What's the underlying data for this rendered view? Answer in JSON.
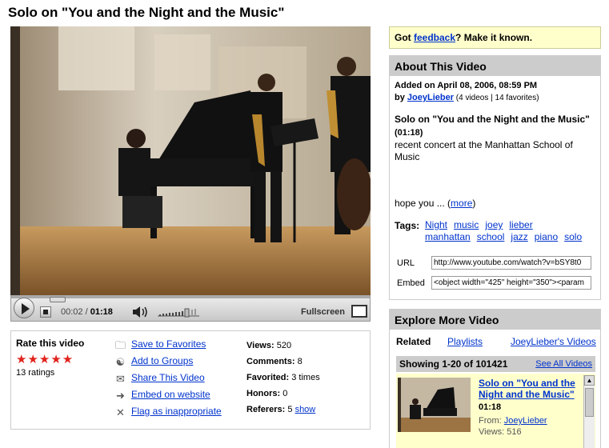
{
  "page": {
    "title": "Solo on \"You and the Night and the Music\""
  },
  "player": {
    "current_time": "00:02",
    "separator": "/",
    "duration": "01:18",
    "fullscreen_label": "Fullscreen"
  },
  "rating": {
    "label": "Rate this video",
    "stars": "★★★★★",
    "count_text": "13 ratings"
  },
  "actions": [
    {
      "label": "Save to Favorites",
      "icon": "folder-icon"
    },
    {
      "label": "Add to Groups",
      "icon": "group-icon"
    },
    {
      "label": "Share This Video",
      "icon": "envelope-icon"
    },
    {
      "label": "Embed on website",
      "icon": "embed-icon"
    },
    {
      "label": "Flag as inappropriate",
      "icon": "flag-x-icon"
    }
  ],
  "stats": {
    "views_label": "Views:",
    "views": "520",
    "comments_label": "Comments:",
    "comments": "8",
    "favorited_label": "Favorited:",
    "favorited": "3 times",
    "honors_label": "Honors:",
    "honors": "0",
    "referers_label": "Referers:",
    "referers": "5",
    "show_link": "show"
  },
  "feedback": {
    "prefix": "Got ",
    "link": "feedback",
    "suffix": "?  Make it known."
  },
  "about": {
    "heading": "About This Video",
    "added": "Added on April 08, 2006, 08:59 PM",
    "by_label": "by ",
    "author": "JoeyLieber",
    "author_meta": " (4 videos | 14 favorites)",
    "desc_title": "Solo on \"You and the Night and the Music\"",
    "desc_duration": " (01:18)",
    "desc_text": "recent concert at the Manhattan School of Music",
    "hope_text": "hope you  ... (",
    "more_link": "more",
    "hope_close": ")",
    "tags_label": "Tags:",
    "tags": [
      "Night",
      "music",
      "joey",
      "lieber",
      "manhattan",
      "school",
      "jazz",
      "piano",
      "solo"
    ],
    "url_label": "URL",
    "url_value": "http://www.youtube.com/watch?v=bSY8t0",
    "embed_label": "Embed",
    "embed_value": "<object width=\"425\" height=\"350\"><param"
  },
  "explore": {
    "heading": "Explore More Video",
    "tab_related": "Related",
    "tab_playlists": "Playlists",
    "tab_user": "JoeyLieber's Videos",
    "showing": "Showing 1-20 of 101421",
    "see_all": "See All Videos",
    "item": {
      "title": "Solo on \"You and the Night and the Music\"",
      "duration": "01:18",
      "from_label": "From: ",
      "from_user": "JoeyLieber",
      "views": "Views: 516"
    }
  },
  "colors": {
    "link": "#0033cc",
    "star": "#e0221b",
    "feedback_bg": "#ffffcc",
    "panel_header": "#cccccc"
  }
}
